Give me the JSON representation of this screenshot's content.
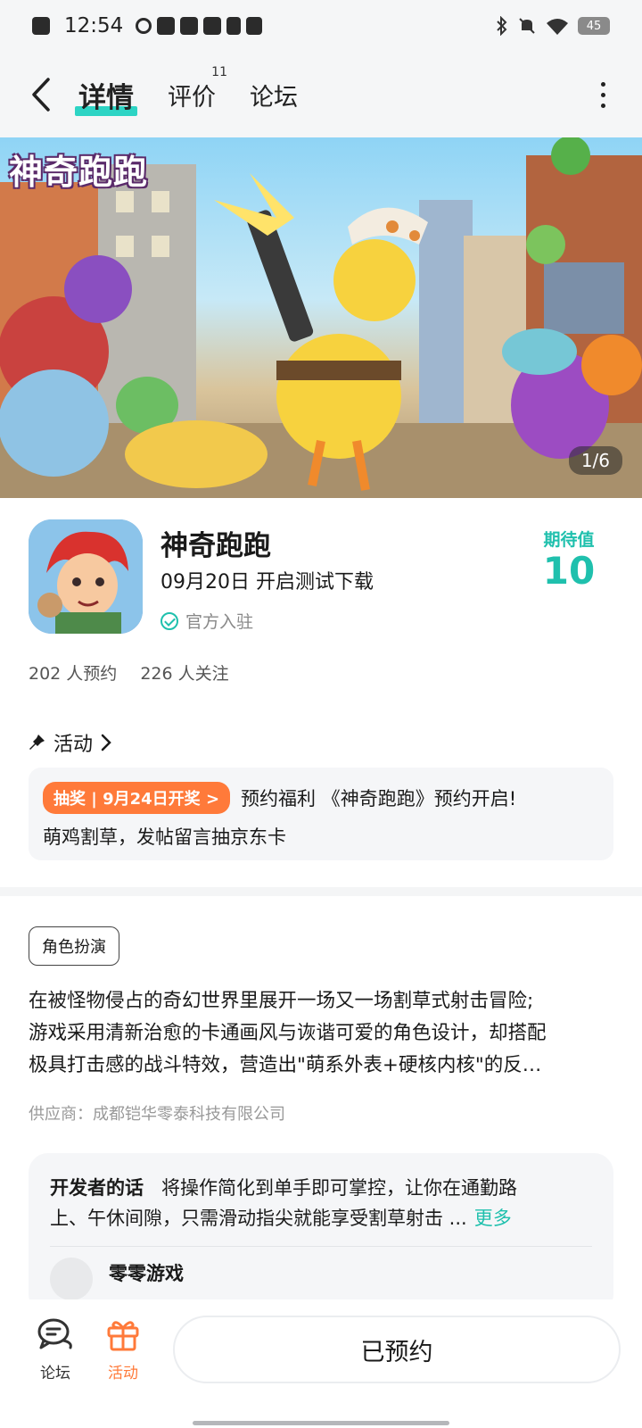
{
  "status_bar": {
    "time": "12:54",
    "battery": "45"
  },
  "nav": {
    "tabs": [
      {
        "label": "详情",
        "active": true
      },
      {
        "label": "评价",
        "badge": "11"
      },
      {
        "label": "论坛"
      }
    ]
  },
  "banner": {
    "logo_text": "神奇跑跑",
    "counter": "1/6"
  },
  "game": {
    "title": "神奇跑跑",
    "date_text": "09月20日  开启测试下载",
    "official": "官方入驻",
    "expect_label": "期待值",
    "expect_value": "10"
  },
  "stats": {
    "reserve": "202  人预约",
    "follow": "226  人关注"
  },
  "activity": {
    "title": "活动",
    "tag": "抽奖 | 9月24日开奖 >",
    "text1": "预约福利 《神奇跑跑》预约开启!",
    "text2": "萌鸡割草，发帖留言抽京东卡"
  },
  "genre": "角色扮演",
  "description": [
    "在被怪物侵占的奇幻世界里展开一场又一场割草式射击冒险;",
    "游戏采用清新治愈的卡通画风与诙谐可爱的角色设计，却搭配",
    "极具打击感的战斗特效，营造出\"萌系外表+硬核内核\"的反…"
  ],
  "supplier": "供应商：成都铠华零泰科技有限公司",
  "developer": {
    "label": "开发者的话",
    "text_line1": "将操作简化到单手即可掌控，让你在通勤路",
    "text_line2": "上、午休间隙，只需滑动指尖就能享受割草射击 ...",
    "more": "更多",
    "author": "零零游戏"
  },
  "bottom": {
    "forum": "论坛",
    "activity": "活动",
    "reserve_button": "已预约"
  },
  "colors": {
    "accent": "#1fc0ad",
    "tab_underline": "#2dd4c4",
    "orange": "#ff7a3a"
  }
}
